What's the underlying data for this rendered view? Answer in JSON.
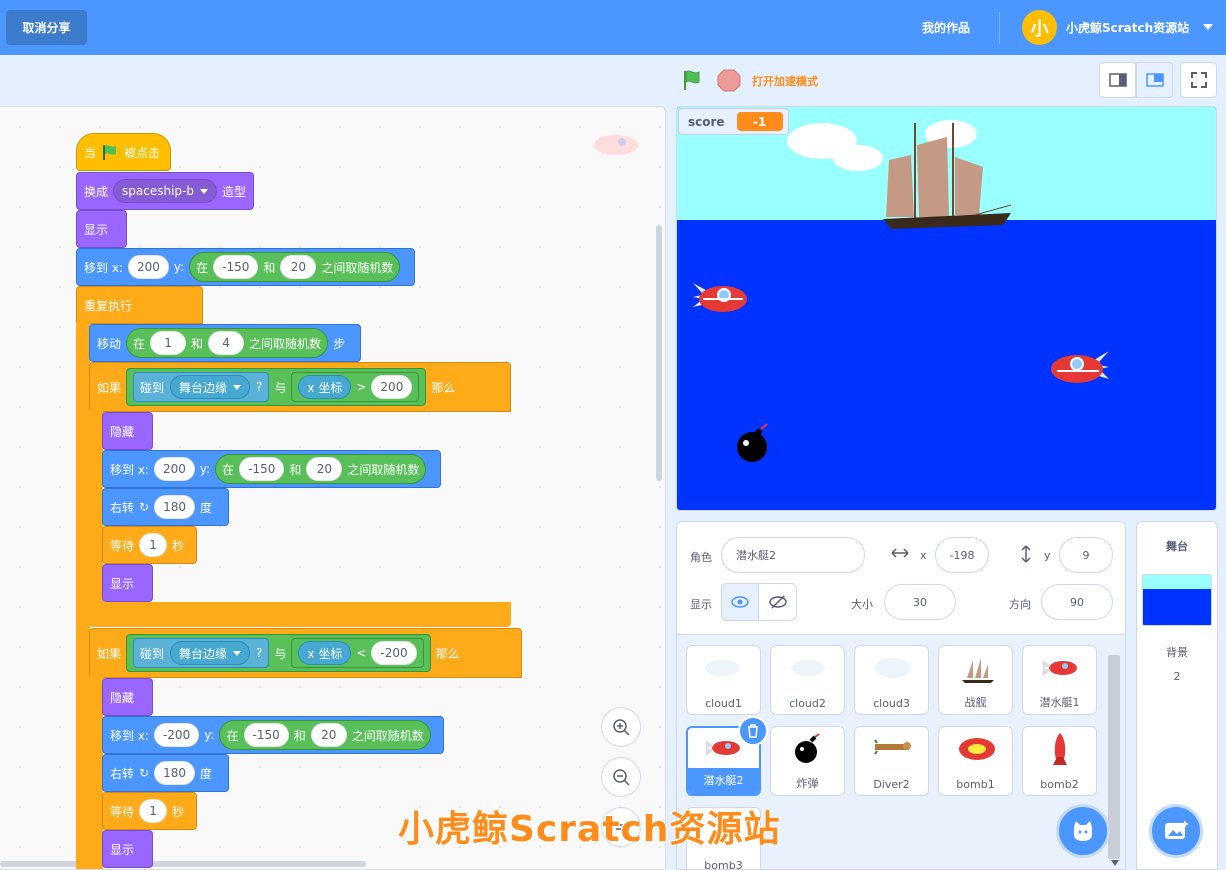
{
  "header": {
    "cancel_share_label": "取消分享",
    "my_works_label": "我的作品",
    "avatar_char": "小",
    "username": "小虎鲸Scratch资源站"
  },
  "stage_controls": {
    "turbo_label": "打开加速模式"
  },
  "code": {
    "hat": {
      "prefix": "当",
      "suffix": "被点击"
    },
    "switch_costume": {
      "label": "换成",
      "costume": "spaceship-b",
      "suffix": "造型"
    },
    "show1": "显示",
    "goto1": {
      "label": "移到 x:",
      "x": "200",
      "y_label": "y:",
      "rand_prefix": "在",
      "from": "-150",
      "and": "和",
      "to": "20",
      "rand_suffix": "之间取随机数"
    },
    "forever": "重复执行",
    "move": {
      "label": "移动",
      "rand_prefix": "在",
      "from": "1",
      "and": "和",
      "to": "4",
      "rand_suffix": "之间取随机数",
      "suffix": "步"
    },
    "if1": {
      "label": "如果",
      "touching": "碰到",
      "target": "舞台边缘",
      "q": "?",
      "and": "与",
      "xpos": "x 坐标",
      "op": ">",
      "value": "200",
      "then": "那么"
    },
    "hide1": "隐藏",
    "goto2": {
      "label": "移到 x:",
      "x": "200",
      "y_label": "y:",
      "rand_prefix": "在",
      "from": "-150",
      "and": "和",
      "to": "20",
      "rand_suffix": "之间取随机数"
    },
    "turn1": {
      "label": "右转",
      "value": "180",
      "suffix": "度"
    },
    "wait1": {
      "label": "等待",
      "value": "1",
      "suffix": "秒"
    },
    "show2": "显示",
    "if2": {
      "label": "如果",
      "touching": "碰到",
      "target": "舞台边缘",
      "q": "?",
      "and": "与",
      "xpos": "x 坐标",
      "op": "<",
      "value": "-200",
      "then": "那么"
    },
    "hide2": "隐藏",
    "goto3": {
      "label": "移到 x:",
      "x": "-200",
      "y_label": "y:",
      "rand_prefix": "在",
      "from": "-150",
      "and": "和",
      "to": "20",
      "rand_suffix": "之间取随机数"
    },
    "turn2": {
      "label": "右转",
      "value": "180",
      "suffix": "度"
    },
    "wait2": {
      "label": "等待",
      "value": "1",
      "suffix": "秒"
    },
    "show3": "显示"
  },
  "stage": {
    "monitor_label": "score",
    "monitor_value": "-1"
  },
  "sprite_info": {
    "sprite_label": "角色",
    "sprite_name": "潜水艇2",
    "x_label": "x",
    "x_value": "-198",
    "y_label": "y",
    "y_value": "9",
    "show_label": "显示",
    "size_label": "大小",
    "size_value": "30",
    "direction_label": "方向",
    "direction_value": "90"
  },
  "sprites": [
    {
      "name": "cloud1"
    },
    {
      "name": "cloud2"
    },
    {
      "name": "cloud3"
    },
    {
      "name": "战舰"
    },
    {
      "name": "潜水艇1"
    },
    {
      "name": "潜水艇2"
    },
    {
      "name": "炸弹"
    },
    {
      "name": "Diver2"
    },
    {
      "name": "bomb1"
    },
    {
      "name": "bomb2"
    },
    {
      "name": "bomb3"
    }
  ],
  "stage_pane": {
    "title": "舞台",
    "backdrop_label": "背景",
    "backdrop_count": "2"
  },
  "watermark": "小虎鲸Scratch资源站",
  "colors": {
    "accent": "#4c97ff",
    "events": "#ffbf00",
    "looks": "#9966ff",
    "motion": "#4c97ff",
    "control": "#ffab19",
    "operators": "#59c059",
    "sensing": "#5cb1d6"
  }
}
